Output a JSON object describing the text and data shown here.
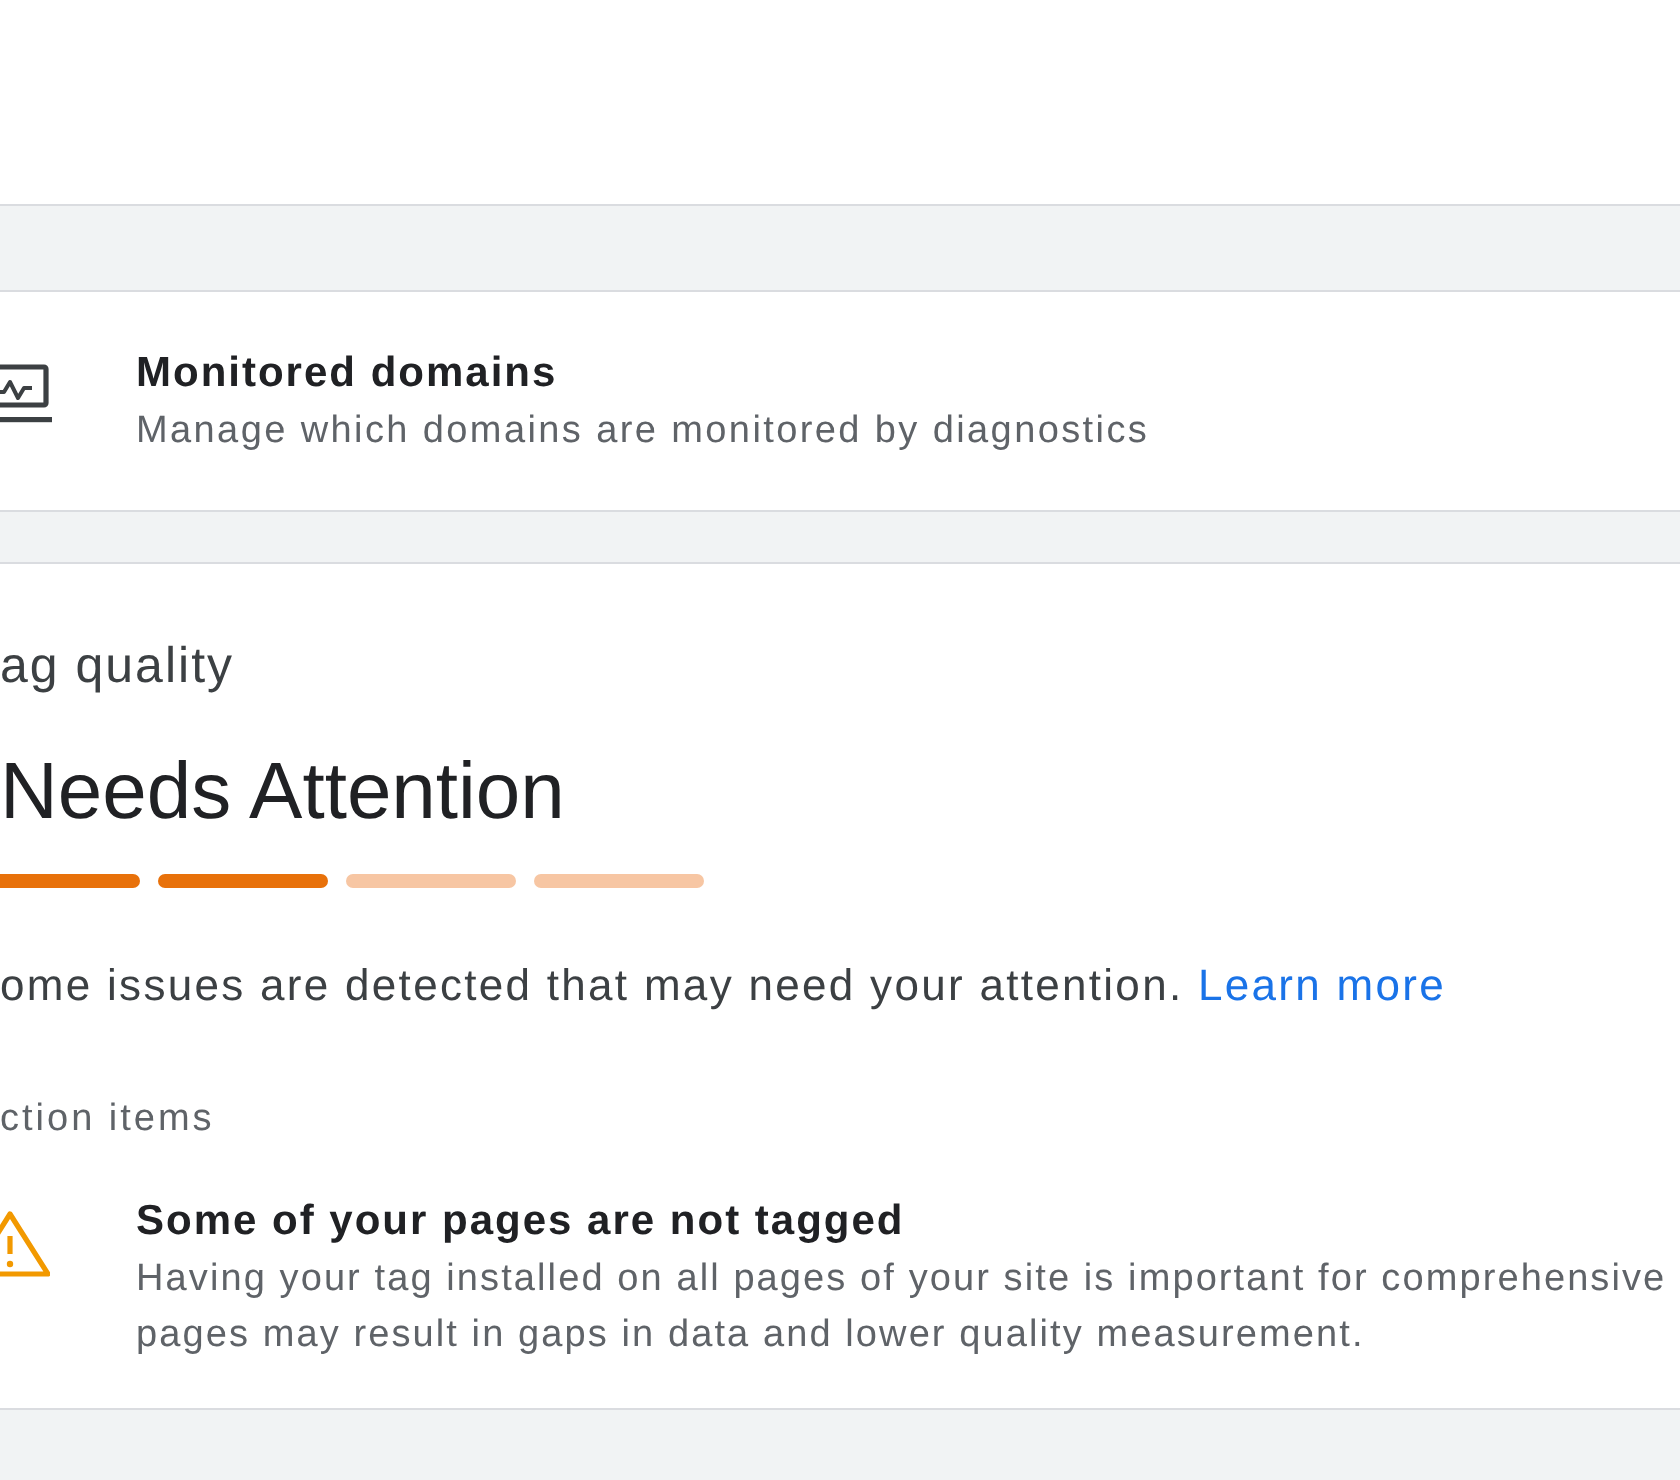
{
  "domains_card": {
    "title": "Monitored domains",
    "subtitle": "Manage which domains are monitored by diagnostics"
  },
  "tag_quality": {
    "heading": "ag quality",
    "status": "Needs Attention",
    "meter": [
      {
        "filled": true
      },
      {
        "filled": true
      },
      {
        "filled": false
      },
      {
        "filled": false
      }
    ],
    "message": "ome issues are detected that may need your attention.",
    "link": "Learn more",
    "section_label": "ction items",
    "action_items": [
      {
        "kind": "warning",
        "title": "Some of your pages are not tagged",
        "description": [
          "Having your tag installed on all pages of your site is important for comprehensive",
          "pages may result in gaps in data and lower quality measurement."
        ]
      }
    ]
  }
}
